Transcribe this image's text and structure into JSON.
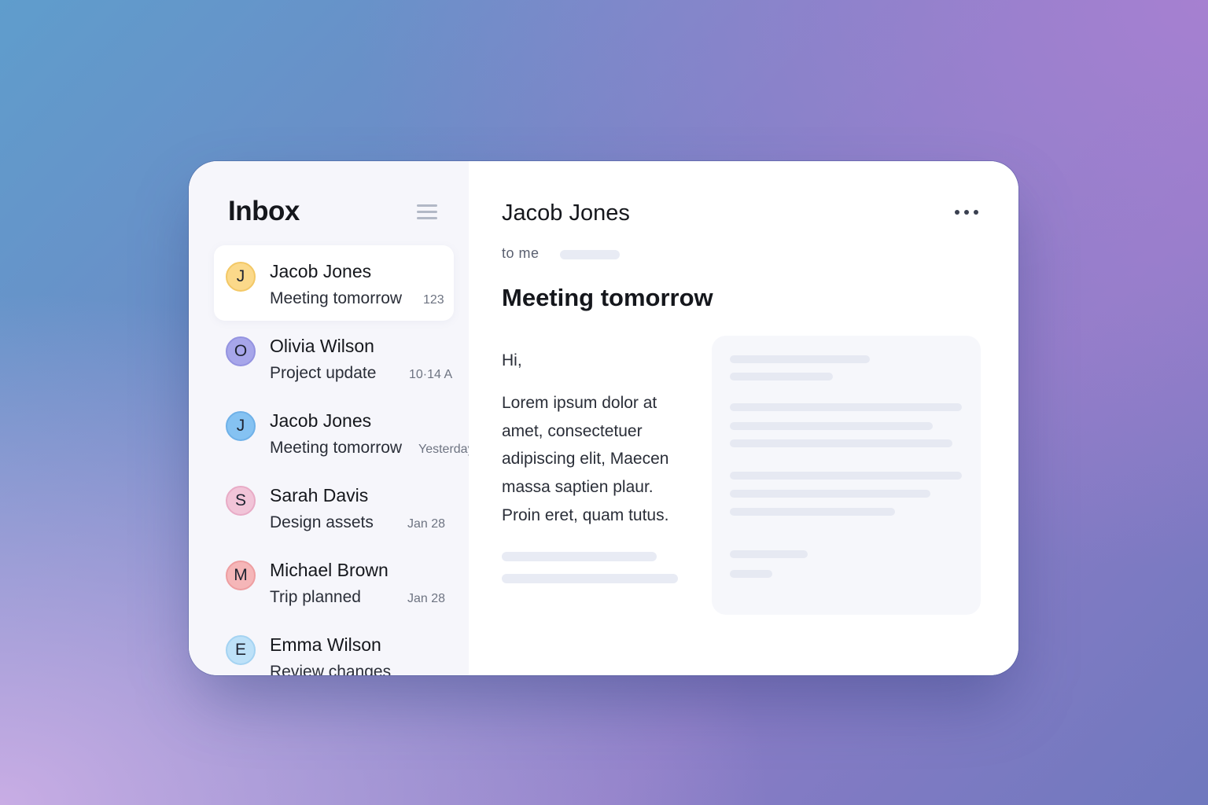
{
  "sidebar": {
    "title": "Inbox",
    "menu_icon": "hamburger-menu-icon",
    "messages": [
      {
        "initial": "J",
        "sender": "Jacob Jones",
        "subject": "Meeting tomorrow",
        "time": "123",
        "avatar_color": "#fbd98a",
        "avatar_border": "#f3c866",
        "selected": true
      },
      {
        "initial": "O",
        "sender": "Olivia Wilson",
        "subject": "Project update",
        "time": "10·14 A",
        "avatar_color": "#a7a6ea",
        "avatar_border": "#9493e0",
        "selected": false
      },
      {
        "initial": "J",
        "sender": "Jacob Jones",
        "subject": "Meeting tomorrow",
        "time": "Yesterday",
        "avatar_color": "#85c2f2",
        "avatar_border": "#6fb1e8",
        "selected": false
      },
      {
        "initial": "S",
        "sender": "Sarah Davis",
        "subject": "Design assets",
        "time": "Jan 28",
        "avatar_color": "#f1c4d8",
        "avatar_border": "#e8abc6",
        "selected": false
      },
      {
        "initial": "M",
        "sender": "Michael Brown",
        "subject": "Trip planned",
        "time": "Jan 28",
        "avatar_color": "#f5b6b8",
        "avatar_border": "#ee9ea1",
        "selected": false
      },
      {
        "initial": "E",
        "sender": "Emma Wilson",
        "subject": "Review changes",
        "time": "",
        "avatar_color": "#bde1f8",
        "avatar_border": "#a4d3f2",
        "selected": false
      }
    ]
  },
  "reader": {
    "sender": "Jacob Jones",
    "recipient": "to me",
    "subject": "Meeting tomorrow",
    "greeting": "Hi,",
    "body": "Lorem ipsum dolor at amet, consectetuer adipiscing elit, Maecen massa saptien plaur. Proin eret, quam tutus.",
    "more_icon": "more-horizontal-icon"
  },
  "colors": {
    "background_start": "#5f9dcc",
    "background_end": "#a57fd0",
    "sidebar_bg": "#f6f6fb",
    "placeholder": "#e8ebf4",
    "text_primary": "#15171c"
  }
}
